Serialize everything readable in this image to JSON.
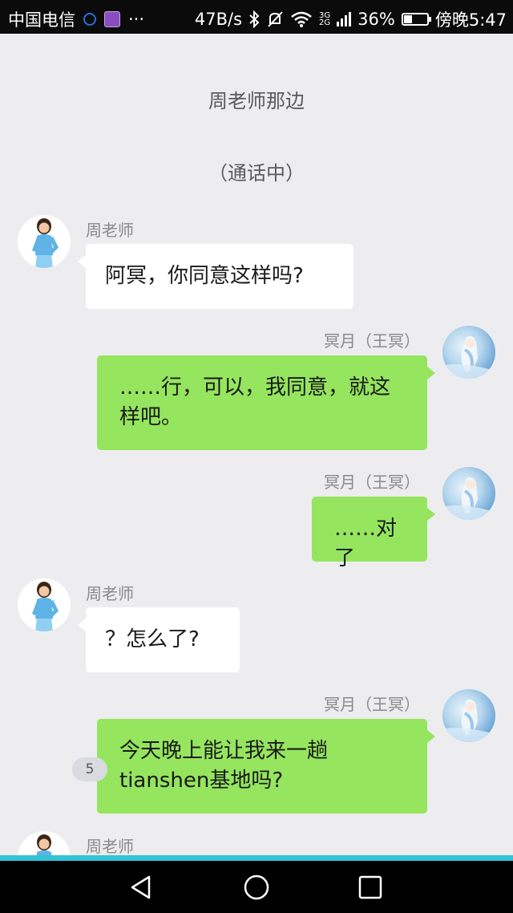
{
  "status_bar": {
    "carrier": "中国电信",
    "more": "···",
    "net_speed": "47B/s",
    "network_type_top": "3G",
    "network_type_bottom": "2G",
    "battery_percent_text": "36%",
    "battery_level": 0.36,
    "time": "傍晚5:47"
  },
  "scene": {
    "location": "周老师那边",
    "status": "（通话中）"
  },
  "messages": [
    {
      "sender": "周老师",
      "side": "left",
      "avatar": "teacher-avatar",
      "text_lines": [
        "阿冥，你同意这样吗?"
      ]
    },
    {
      "sender": "冥月（王冥）",
      "side": "right",
      "avatar": "mingyue-avatar",
      "text_lines": [
        "……行，可以，我同意，就这",
        "样吧。"
      ]
    },
    {
      "sender": "冥月（王冥）",
      "side": "right",
      "avatar": "mingyue-avatar",
      "text_lines": [
        "……对了"
      ]
    },
    {
      "sender": "周老师",
      "side": "left",
      "avatar": "teacher-avatar",
      "text_lines": [
        "？怎么了?"
      ]
    },
    {
      "sender": "冥月（王冥）",
      "side": "right",
      "avatar": "mingyue-avatar",
      "text_lines": [
        "今天晚上能让我来一趟",
        "tianshen基地吗?"
      ]
    },
    {
      "sender": "周老师",
      "side": "left",
      "avatar": "teacher-avatar",
      "text_lines": []
    }
  ],
  "unread_badge": "5",
  "nav": {
    "back_icon": "back-triangle-icon",
    "home_icon": "home-circle-icon",
    "recent_icon": "recent-square-icon"
  },
  "colors": {
    "chat_background": "#ededf0",
    "bubble_self": "#95e55f",
    "bubble_other": "#ffffff",
    "accent_line": "#33c3d6"
  }
}
